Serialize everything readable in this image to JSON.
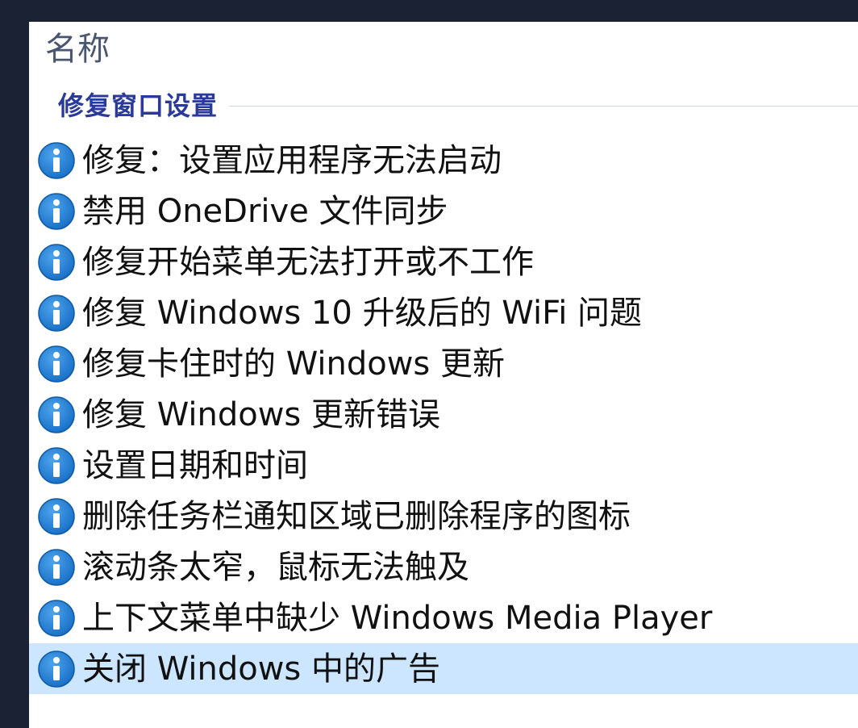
{
  "list": {
    "column_header": "名称",
    "group_title": "修复窗口设置",
    "items": [
      {
        "label": "修复：设置应用程序无法启动",
        "icon": "info-icon"
      },
      {
        "label": "禁用 OneDrive 文件同步",
        "icon": "info-icon"
      },
      {
        "label": "修复开始菜单无法打开或不工作",
        "icon": "info-icon"
      },
      {
        "label": "修复 Windows 10 升级后的 WiFi 问题",
        "icon": "info-icon"
      },
      {
        "label": "修复卡住时的 Windows 更新",
        "icon": "info-icon"
      },
      {
        "label": "修复 Windows 更新错误",
        "icon": "info-icon"
      },
      {
        "label": "设置日期和时间",
        "icon": "info-icon"
      },
      {
        "label": "删除任务栏通知区域已删除程序的图标",
        "icon": "info-icon"
      },
      {
        "label": "滚动条太窄，鼠标无法触及",
        "icon": "info-icon"
      },
      {
        "label": "上下文菜单中缺少 Windows Media Player",
        "icon": "info-icon"
      },
      {
        "label": "关闭 Windows 中的广告",
        "icon": "info-icon"
      }
    ],
    "selected_index": 10
  },
  "colors": {
    "background": "#1a2233",
    "panel": "#ffffff",
    "selection": "#cce6ff",
    "group_title": "#2a3a9a",
    "icon": "#1a72c8"
  }
}
